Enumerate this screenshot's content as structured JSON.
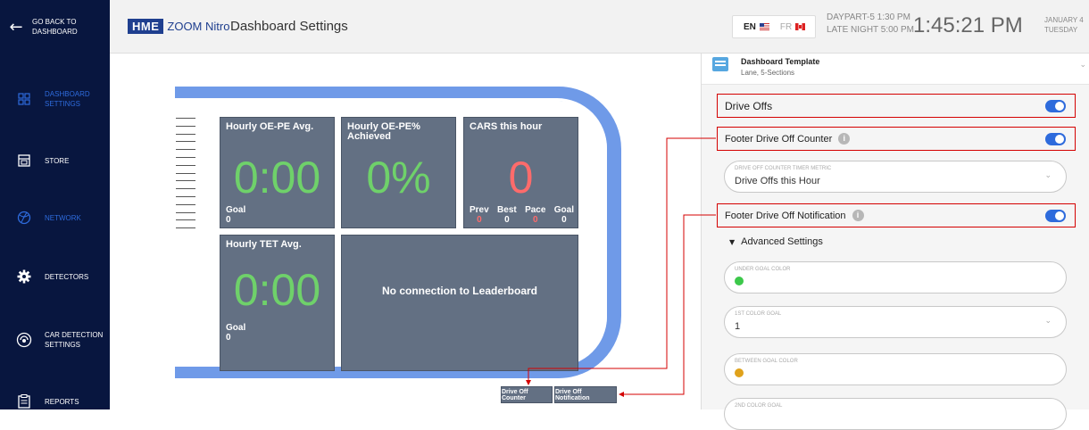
{
  "sidebar": {
    "back_label": "GO BACK TO DASHBOARD",
    "items": [
      {
        "label": "DASHBOARD SETTINGS",
        "icon": "dashboard-icon",
        "active": true
      },
      {
        "label": "STORE",
        "icon": "store-icon",
        "active": false
      },
      {
        "label": "NETWORK",
        "icon": "network-icon",
        "active": true
      },
      {
        "label": "DETECTORS",
        "icon": "gear-icon",
        "active": false
      },
      {
        "label": "CAR DETECTION SETTINGS",
        "icon": "car-detection-icon",
        "active": false
      },
      {
        "label": "REPORTS",
        "icon": "reports-icon",
        "active": false
      }
    ]
  },
  "header": {
    "logo_hme": "HME",
    "logo_product": "ZOOM Nitro",
    "title": "Dashboard Settings",
    "lang_en": "EN",
    "lang_fr": "FR",
    "daypart_line1": "DAYPART-5  1:30 PM",
    "daypart_line2": "LATE NIGHT  5:00 PM",
    "clock": "1:45:21 PM",
    "date_line1": "JANUARY 4",
    "date_line2": "TUESDAY"
  },
  "preview": {
    "tiles": {
      "oepe_title": "Hourly OE-PE Avg.",
      "oepe_value": "0:00",
      "oepe_goal_label": "Goal",
      "oepe_goal_value": "0",
      "pct_title": "Hourly OE-PE% Achieved",
      "pct_value": "0%",
      "cars_title": "CARS this hour",
      "cars_value": "0",
      "cars_stats": [
        {
          "label": "Prev",
          "value": "0"
        },
        {
          "label": "Best",
          "value": "0"
        },
        {
          "label": "Pace",
          "value": "0"
        },
        {
          "label": "Goal",
          "value": "0"
        }
      ],
      "tet_title": "Hourly TET Avg.",
      "tet_value": "0:00",
      "tet_goal_label": "Goal",
      "tet_goal_value": "0",
      "leaderboard_text": "No connection to Leaderboard"
    },
    "footer_buttons": {
      "counter": "Drive Off Counter",
      "notification": "Drive Off Notification"
    }
  },
  "panel": {
    "template_title": "Dashboard Template",
    "template_sub": "Lane, 5-Sections",
    "drive_offs_label": "Drive Offs",
    "footer_counter_label": "Footer Drive Off Counter",
    "timer_metric_label": "DRIVE OFF COUNTER TIMER METRIC",
    "timer_metric_value": "Drive Offs this Hour",
    "footer_notification_label": "Footer Drive Off Notification",
    "advanced_label": "Advanced Settings",
    "under_goal_label": "UNDER GOAL COLOR",
    "first_goal_label": "1ST COLOR GOAL",
    "first_goal_value": "1",
    "between_goal_label": "BETWEEN GOAL COLOR",
    "second_goal_label": "2ND COLOR GOAL"
  },
  "colors": {
    "sidebar_bg": "#08163f",
    "accent": "#2e6bdc",
    "tile_bg": "#637083",
    "green_value": "#6fd16a",
    "red_value": "#ff6b6b",
    "under_goal_dot": "#3cc84a",
    "between_goal_dot": "#e0a21b",
    "highlight_border": "#d40000"
  }
}
